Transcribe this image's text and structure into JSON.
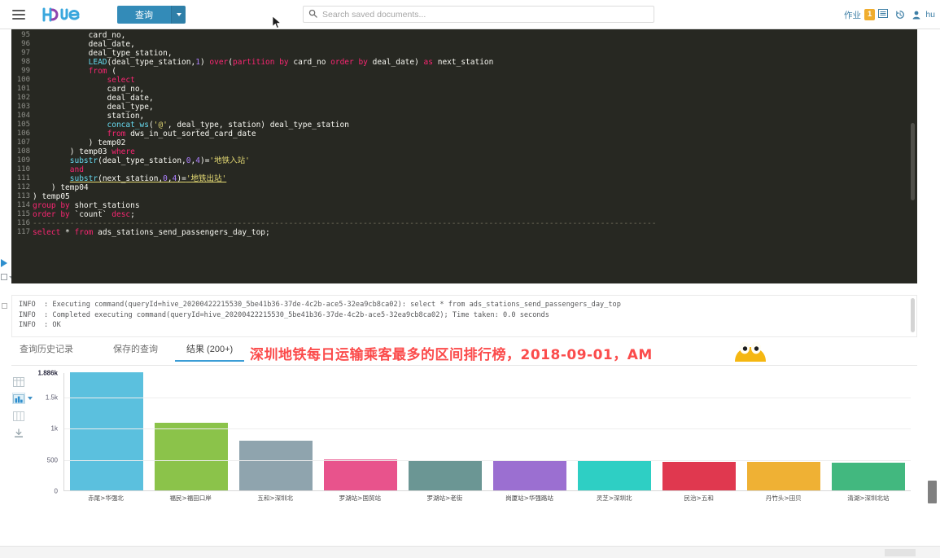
{
  "topnav": {
    "brand": "Hue",
    "query_button": "查询",
    "search_placeholder": "Search saved documents...",
    "jobs_label": "作业",
    "jobs_badge": "1",
    "user_label": "hu"
  },
  "editor": {
    "first_line_no": 95,
    "lines": [
      {
        "n": 95,
        "tokens": [
          {
            "t": "            card_no,",
            "c": "id"
          }
        ]
      },
      {
        "n": 96,
        "tokens": [
          {
            "t": "            deal_date,",
            "c": "id"
          }
        ]
      },
      {
        "n": 97,
        "tokens": [
          {
            "t": "            deal_type_station,",
            "c": "id"
          }
        ]
      },
      {
        "n": 98,
        "tokens": [
          {
            "t": "            ",
            "c": "id"
          },
          {
            "t": "LEAD",
            "c": "fn"
          },
          {
            "t": "(deal_type_station,",
            "c": "id"
          },
          {
            "t": "1",
            "c": "num"
          },
          {
            "t": ") ",
            "c": "id"
          },
          {
            "t": "over",
            "c": "k"
          },
          {
            "t": "(",
            "c": "id"
          },
          {
            "t": "partition by",
            "c": "k"
          },
          {
            "t": " card_no ",
            "c": "id"
          },
          {
            "t": "order by",
            "c": "k"
          },
          {
            "t": " deal_date) ",
            "c": "id"
          },
          {
            "t": "as",
            "c": "k"
          },
          {
            "t": " next_station",
            "c": "id"
          }
        ]
      },
      {
        "n": 99,
        "tokens": [
          {
            "t": "            ",
            "c": "id"
          },
          {
            "t": "from",
            "c": "k"
          },
          {
            "t": " (",
            "c": "id"
          }
        ]
      },
      {
        "n": 100,
        "tokens": [
          {
            "t": "                ",
            "c": "id"
          },
          {
            "t": "select",
            "c": "k"
          }
        ]
      },
      {
        "n": 101,
        "tokens": [
          {
            "t": "                card_no,",
            "c": "id"
          }
        ]
      },
      {
        "n": 102,
        "tokens": [
          {
            "t": "                deal_date,",
            "c": "id"
          }
        ]
      },
      {
        "n": 103,
        "tokens": [
          {
            "t": "                deal_type,",
            "c": "id"
          }
        ]
      },
      {
        "n": 104,
        "tokens": [
          {
            "t": "                station,",
            "c": "id"
          }
        ]
      },
      {
        "n": 105,
        "tokens": [
          {
            "t": "                ",
            "c": "id"
          },
          {
            "t": "concat_ws",
            "c": "fn"
          },
          {
            "t": "(",
            "c": "id"
          },
          {
            "t": "'@'",
            "c": "str"
          },
          {
            "t": ", deal_type, station) deal_type_station",
            "c": "id"
          }
        ]
      },
      {
        "n": 106,
        "tokens": [
          {
            "t": "                ",
            "c": "id"
          },
          {
            "t": "from",
            "c": "k"
          },
          {
            "t": " dws_in_out_sorted_card_date",
            "c": "id"
          }
        ]
      },
      {
        "n": 107,
        "tokens": [
          {
            "t": "            ) temp02",
            "c": "id"
          }
        ]
      },
      {
        "n": 108,
        "tokens": [
          {
            "t": "        ) temp03 ",
            "c": "id"
          },
          {
            "t": "where",
            "c": "k"
          }
        ]
      },
      {
        "n": 109,
        "tokens": [
          {
            "t": "        ",
            "c": "id"
          },
          {
            "t": "substr",
            "c": "fn"
          },
          {
            "t": "(deal_type_station,",
            "c": "id"
          },
          {
            "t": "0",
            "c": "num"
          },
          {
            "t": ",",
            "c": "id"
          },
          {
            "t": "4",
            "c": "num"
          },
          {
            "t": ")=",
            "c": "id"
          },
          {
            "t": "'地铁入站'",
            "c": "str"
          }
        ]
      },
      {
        "n": 110,
        "tokens": [
          {
            "t": "        ",
            "c": "id"
          },
          {
            "t": "and",
            "c": "k"
          }
        ]
      },
      {
        "n": 111,
        "tokens": [
          {
            "t": "        ",
            "c": "id"
          },
          {
            "t": "substr",
            "c": "fn uline"
          },
          {
            "t": "(next_station,",
            "c": "id uline"
          },
          {
            "t": "0",
            "c": "num uline"
          },
          {
            "t": ",",
            "c": "id uline"
          },
          {
            "t": "4",
            "c": "num uline"
          },
          {
            "t": ")=",
            "c": "id uline"
          },
          {
            "t": "'地铁出站'",
            "c": "str uline"
          }
        ]
      },
      {
        "n": 112,
        "tokens": [
          {
            "t": "    ) temp04",
            "c": "id"
          }
        ]
      },
      {
        "n": 113,
        "tokens": [
          {
            "t": ") temp05",
            "c": "id"
          }
        ]
      },
      {
        "n": 114,
        "tokens": [
          {
            "t": "group by",
            "c": "k"
          },
          {
            "t": " short_stations",
            "c": "id"
          }
        ]
      },
      {
        "n": 115,
        "tokens": [
          {
            "t": "order by",
            "c": "k"
          },
          {
            "t": " `count` ",
            "c": "id"
          },
          {
            "t": "desc",
            "c": "k"
          },
          {
            "t": ";",
            "c": "id"
          }
        ]
      },
      {
        "n": 116,
        "tokens": [
          {
            "t": "--------------------------------------------------------------------------------------------------------------------------------------",
            "c": "cm"
          }
        ]
      },
      {
        "n": 117,
        "tokens": [
          {
            "t": "select",
            "c": "k"
          },
          {
            "t": " * ",
            "c": "id"
          },
          {
            "t": "from",
            "c": "k"
          },
          {
            "t": " ads_stations_send_passengers_day_top;",
            "c": "id"
          }
        ]
      }
    ]
  },
  "log": {
    "lines": [
      "INFO  : Executing command(queryId=hive_20200422215530_5be41b36-37de-4c2b-ace5-32ea9cb8ca02): select * from ads_stations_send_passengers_day_top",
      "INFO  : Completed executing command(queryId=hive_20200422215530_5be41b36-37de-4c2b-ace5-32ea9cb8ca02); Time taken: 0.0 seconds",
      "INFO  : OK"
    ]
  },
  "tabs": [
    {
      "label": "查询历史记录",
      "active": false
    },
    {
      "label": "保存的查询",
      "active": false
    },
    {
      "label": "结果 (200+)",
      "active": true
    }
  ],
  "annotation": {
    "text": "深圳地铁每日运输乘客最多的区间排行榜，2018-09-01，AM",
    "color": "#fb4b4b"
  },
  "chart_toolbar": [
    {
      "name": "grid-view-icon",
      "selected": false
    },
    {
      "name": "bar-chart-icon",
      "selected": true
    },
    {
      "name": "column-view-icon",
      "selected": false
    },
    {
      "name": "download-icon",
      "selected": false
    }
  ],
  "chart_data": {
    "type": "bar",
    "title": "深圳地铁每日运输乘客最多的区间排行榜，2018-09-01，AM",
    "xlabel": "",
    "ylabel": "",
    "ylim": [
      0,
      1886
    ],
    "grid": true,
    "legend": "none",
    "ytick_labels": [
      "0",
      "500",
      "1k",
      "1.5k"
    ],
    "ytick_values": [
      0,
      500,
      1000,
      1500
    ],
    "ymax_label": "1.886k",
    "categories": [
      "赤尾>华强北",
      "福民>福田口岸",
      "五和>深圳北",
      "罗湖站>国贸站",
      "罗湖站>老街",
      "岗厦站>华强路站",
      "灵芝>深圳北",
      "民治>五和",
      "丹竹头>田贝",
      "清湖>深圳北站"
    ],
    "values": [
      1886,
      1080,
      800,
      490,
      485,
      470,
      462,
      455,
      450,
      445
    ],
    "colors": [
      "#5bc0de",
      "#8bc34a",
      "#8fa4ae",
      "#e8538c",
      "#6b9694",
      "#9b6fd1",
      "#2ecfc4",
      "#e0384f",
      "#efb134",
      "#42b87f"
    ]
  }
}
